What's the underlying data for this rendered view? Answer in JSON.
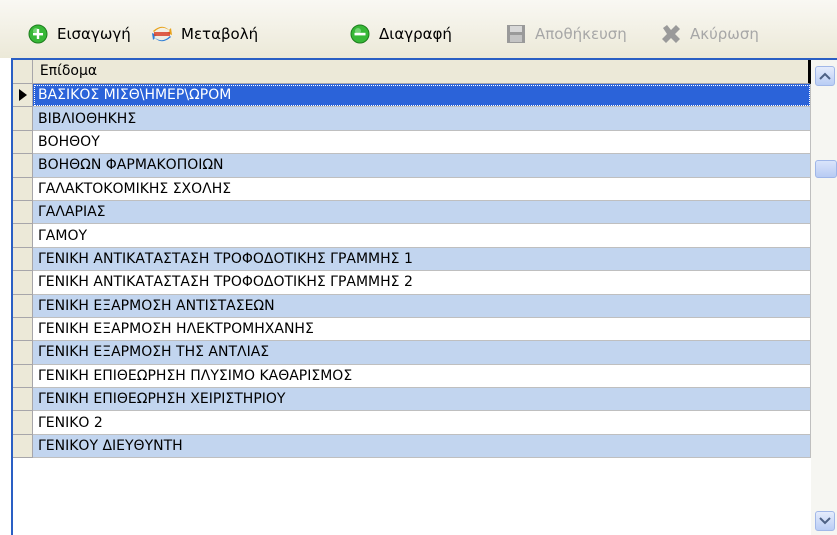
{
  "toolbar": {
    "insert": {
      "label": "Εισαγωγή",
      "icon": "plus-circle-icon",
      "color": "#2ea82e"
    },
    "modify": {
      "label": "Μεταβολή",
      "icon": "swap-arrows-icon"
    },
    "delete": {
      "label": "Διαγραφή",
      "icon": "minus-circle-icon",
      "color": "#2ea82e"
    },
    "save": {
      "label": "Αποθήκευση",
      "icon": "floppy-disk-icon",
      "disabled": true
    },
    "cancel": {
      "label": "Ακύρωση",
      "icon": "cancel-x-icon",
      "disabled": true
    }
  },
  "grid": {
    "column_header": "Επίδομα",
    "selected_index": 0,
    "rows": [
      "ΒΑΣΙΚΟΣ ΜΙΣΘ\\ΗΜΕΡ\\ΩΡΟΜ",
      "ΒΙΒΛΙΟΘΗΚΗΣ",
      "ΒΟΗΘΟΥ",
      "ΒΟΗΘΩΝ ΦΑΡΜΑΚΟΠΟΙΩΝ",
      "ΓΑΛΑΚΤΟΚΟΜΙΚΗΣ ΣΧΟΛΗΣ",
      "ΓΑΛΑΡΙΑΣ",
      "ΓΑΜΟΥ",
      "ΓΕΝΙΚΗ ΑΝΤΙΚΑΤΑΣΤΑΣΗ ΤΡΟΦΟΔΟΤΙΚΗΣ ΓΡΑΜΜΗΣ 1",
      "ΓΕΝΙΚΗ ΑΝΤΙΚΑΤΑΣΤΑΣΗ ΤΡΟΦΟΔΟΤΙΚΗΣ ΓΡΑΜΜΗΣ 2",
      "ΓΕΝΙΚΗ ΕΞΑΡΜΟΣΗ ΑΝΤΙΣΤΑΣΕΩΝ",
      "ΓΕΝΙΚΗ ΕΞΑΡΜΟΣΗ ΗΛΕΚΤΡΟΜΗΧΑΝΗΣ",
      "ΓΕΝΙΚΗ ΕΞΑΡΜΟΣΗ ΤΗΣ ΑΝΤΛΙΑΣ",
      "ΓΕΝΙΚΗ ΕΠΙΘΕΩΡΗΣΗ ΠΛΥΣΙΜΟ ΚΑΘΑΡΙΣΜΟΣ",
      "ΓΕΝΙΚΗ ΕΠΙΘΕΩΡΗΣΗ ΧΕΙΡΙΣΤΗΡΙΟΥ",
      "ΓΕΝΙΚΟ 2",
      "ΓΕΝΙΚΟΥ ΔΙΕΥΘΥΝΤΗ"
    ]
  },
  "colors": {
    "selected_row": "#2b63d9",
    "alt_row": "#c2d5ef",
    "frame_border": "#2a5fc4"
  }
}
